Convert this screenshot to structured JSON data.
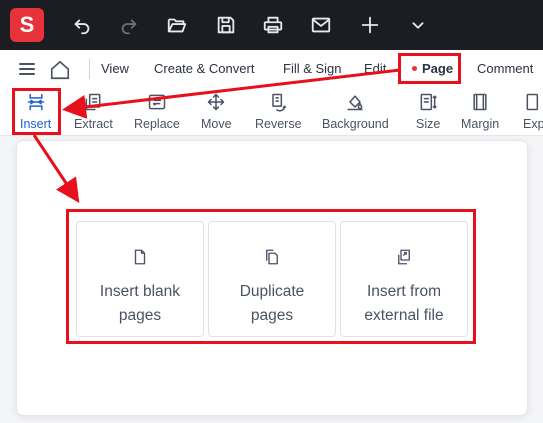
{
  "app": {
    "logo_letter": "S"
  },
  "titlebar": {
    "icons": [
      "undo-icon",
      "redo-icon",
      "open-folder-icon",
      "save-icon",
      "print-icon",
      "email-icon",
      "add-icon",
      "chevron-down-icon"
    ]
  },
  "menubar": {
    "items": [
      "View",
      "Create & Convert",
      "Fill & Sign",
      "Edit",
      "Page",
      "Comment"
    ],
    "active": "Page"
  },
  "toolbar": {
    "tools": [
      "Insert",
      "Extract",
      "Replace",
      "Move",
      "Reverse",
      "Background",
      "Size",
      "Margin",
      "Exp"
    ],
    "active": "Insert"
  },
  "insert_panel": {
    "options": [
      "Insert blank\npages",
      "Duplicate\npages",
      "Insert from\nexternal file"
    ]
  },
  "colors": {
    "accent": "#1f5fd6",
    "annotation": "#e8101c",
    "brand": "#e8323a",
    "titlebar": "#1b1d23"
  }
}
